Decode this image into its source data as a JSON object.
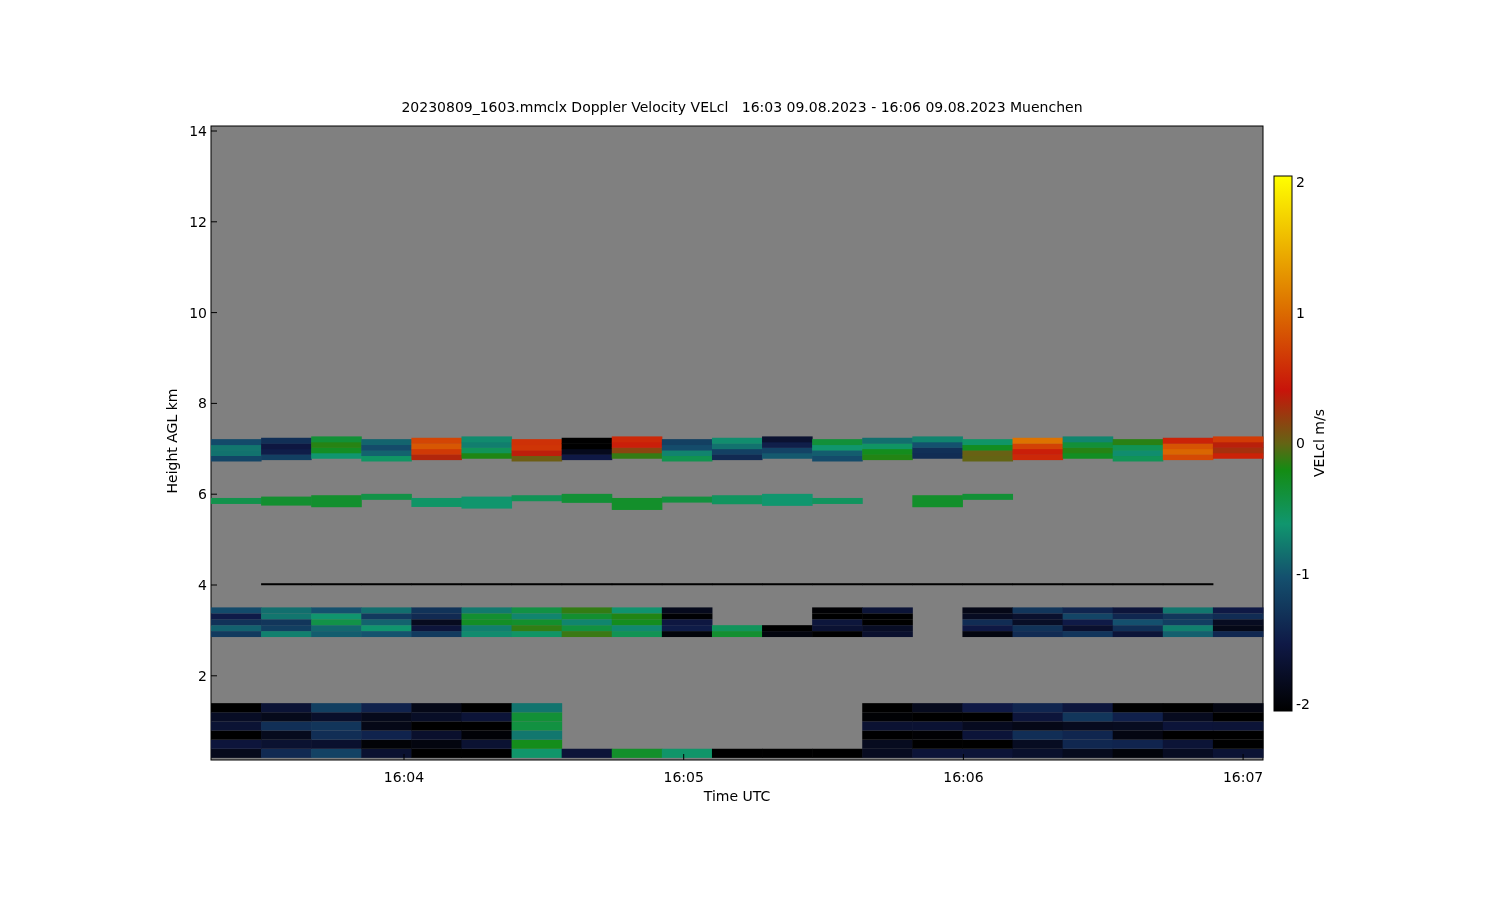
{
  "title": "20230809_1603.mmclx Doppler Velocity VELcl   16:03 09.08.2023 - 16:06 09.08.2023 Muenchen",
  "y_axis": {
    "label": "Height AGL km",
    "ticks": [
      "14",
      "12",
      "10",
      "8",
      "6",
      "4",
      "2"
    ]
  },
  "x_axis": {
    "label": "Time UTC",
    "ticks": [
      "16:04",
      "16:05",
      "16:06",
      "16:07"
    ]
  },
  "colorbar": {
    "label": "VELcl m/s",
    "ticks": [
      "2",
      "1",
      "0",
      "-1",
      "-2"
    ]
  }
}
